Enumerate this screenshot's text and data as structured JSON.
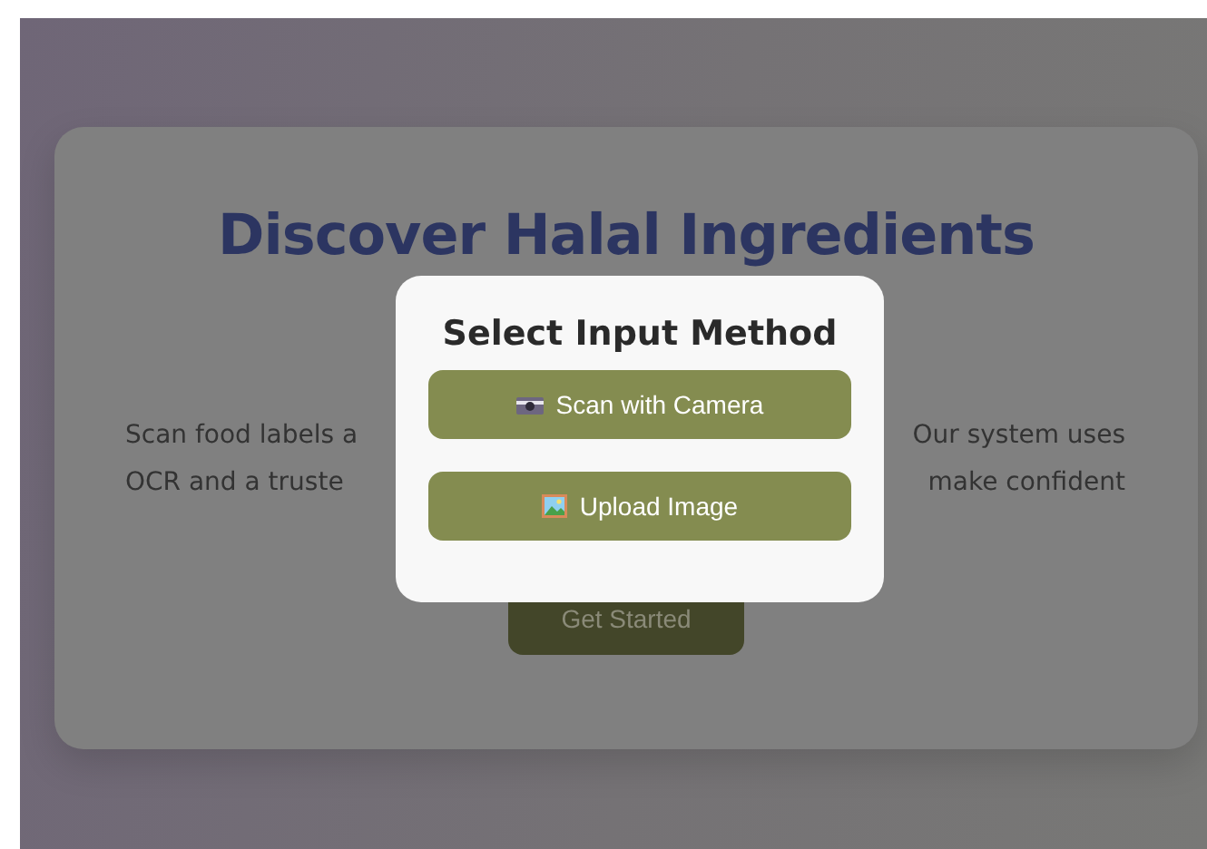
{
  "hero": {
    "title": "Discover Halal Ingredients",
    "description_lines": [
      {
        "left": "Scan food labels a",
        "right": "Our system uses"
      },
      {
        "left": "OCR and a truste",
        "right": "make confident"
      }
    ],
    "cta": "Get Started"
  },
  "modal": {
    "title": "Select Input Method",
    "options": [
      {
        "kind": "camera",
        "label": "Scan with Camera"
      },
      {
        "kind": "image",
        "label": "Upload Image"
      }
    ]
  }
}
